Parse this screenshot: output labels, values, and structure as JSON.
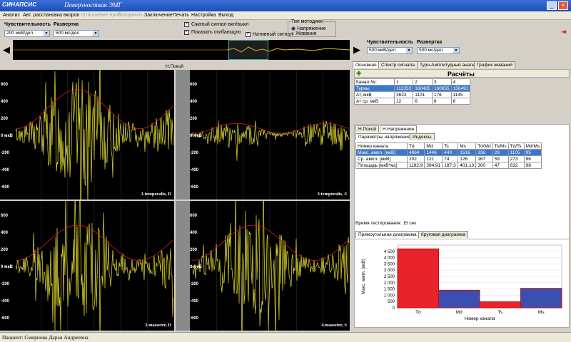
{
  "window": {
    "logo": "СИНАПСИС",
    "title": "Поверхностная ЭМГ"
  },
  "menu": [
    "Анализ",
    "Авт. расстановка вкоров",
    "Отношение проб",
    "Сохранить",
    "Заключение",
    "Печать",
    "Настройка",
    "Выход"
  ],
  "toolbar": {
    "sens_label": "Чувствительность",
    "sens_value": "200 мкВ/дел",
    "sweep_label": "Развертка",
    "sweep_value": "500 мс/дел",
    "cb1": "Сжатый сигнал вкл/выкл",
    "cb2": "Показать огибающую",
    "cb3": "Нативный сигнал",
    "method_label": "Тип методики",
    "radio1": "Напряжение",
    "radio2": "Жевание"
  },
  "right_toolbar": {
    "sens_label": "Чувствительность",
    "sens_value": "500 мкВ/дел",
    "sweep_label": "Развертка",
    "sweep_value": "500 мс/дел"
  },
  "plot": {
    "state_label": "Н.Покой",
    "panels": [
      {
        "label": "1.temporalis, D",
        "ticks": [
          "600",
          "400",
          "200",
          "0 мкВ",
          "-200",
          "-400",
          "-600"
        ]
      },
      {
        "label": "3.temporalis, S",
        "ticks": [
          "600",
          "400",
          "200",
          "0 мкВ",
          "-200",
          "-400",
          "-600"
        ]
      },
      {
        "label": "2.masseter, D",
        "ticks": [
          "600",
          "400",
          "200",
          "0 мкВ",
          "-200",
          "-400",
          "-600"
        ]
      },
      {
        "label": "4.masseter, S",
        "ticks": [
          "600",
          "400",
          "200",
          "0 мкВ",
          "-200",
          "-400",
          "-600"
        ]
      }
    ]
  },
  "right": {
    "tabs": [
      "Основная",
      "Спектр сигнала",
      "Турн-Амплитудный анализ",
      "График жеваний"
    ],
    "calc_title": "Расчёты",
    "table1": {
      "header": [
        "Канал №:",
        "1",
        "2",
        "3",
        "4"
      ],
      "rows": [
        [
          "Турны",
          "112353",
          "160435",
          "160855",
          "156491"
        ],
        [
          "Ат, мкВ",
          "3623",
          "1101",
          "176",
          "1145"
        ],
        [
          "Ат ср, мкВ",
          "12",
          "6",
          "6",
          "6"
        ]
      ]
    },
    "state_tabs": [
      "Н.Покой",
      "Н.Напряжение"
    ],
    "sub_tabs": [
      "Параметры напряжения",
      "Индексы"
    ],
    "table2": {
      "header": [
        "Номер канала",
        "Td",
        "Md",
        "Ts",
        "Ms",
        "Td/Md",
        "Ts/Ms",
        "Td/Ts",
        "Md/Ms"
      ],
      "rows": [
        [
          "Макс. ампл. [мкВ]",
          "4864",
          "1446",
          "440",
          "1516",
          "336",
          "29",
          "1105",
          "95"
        ],
        [
          "Ср. ампл. [мкВ]",
          "202",
          "121",
          "74",
          "126",
          "167",
          "59",
          "273",
          "96"
        ],
        [
          "Площадь [мкВ*мс]",
          "1182,9",
          "394,91",
          "187,3",
          "401,13",
          "300",
          "47",
          "632",
          "98"
        ]
      ]
    },
    "test_time": "Время тестирования: 15 сек",
    "chart_tabs": [
      "Прямоугольная диаграмма",
      "Круговая диаграмма"
    ]
  },
  "chart_data": {
    "type": "bar",
    "categories": [
      "Td",
      "Md",
      "Ts",
      "Ms"
    ],
    "series": [
      {
        "values": [
          4700,
          0,
          480,
          0
        ]
      },
      {
        "values": [
          0,
          1400,
          0,
          1550
        ]
      }
    ],
    "xlabel": "Номер канала",
    "ylabel": "Макс. ампл. (мкВ)",
    "yticks": [
      "4 500",
      "4 000",
      "3 500",
      "3 000",
      "2 500",
      "2 000",
      "1 500",
      "1 000",
      "500",
      "0"
    ],
    "ylim": [
      0,
      5000
    ],
    "colors": {
      "red": "#e8232c",
      "blue": "#3b4fb0"
    }
  },
  "status": {
    "patient": "Пациент: Смирнова Дарья Андреевна"
  }
}
